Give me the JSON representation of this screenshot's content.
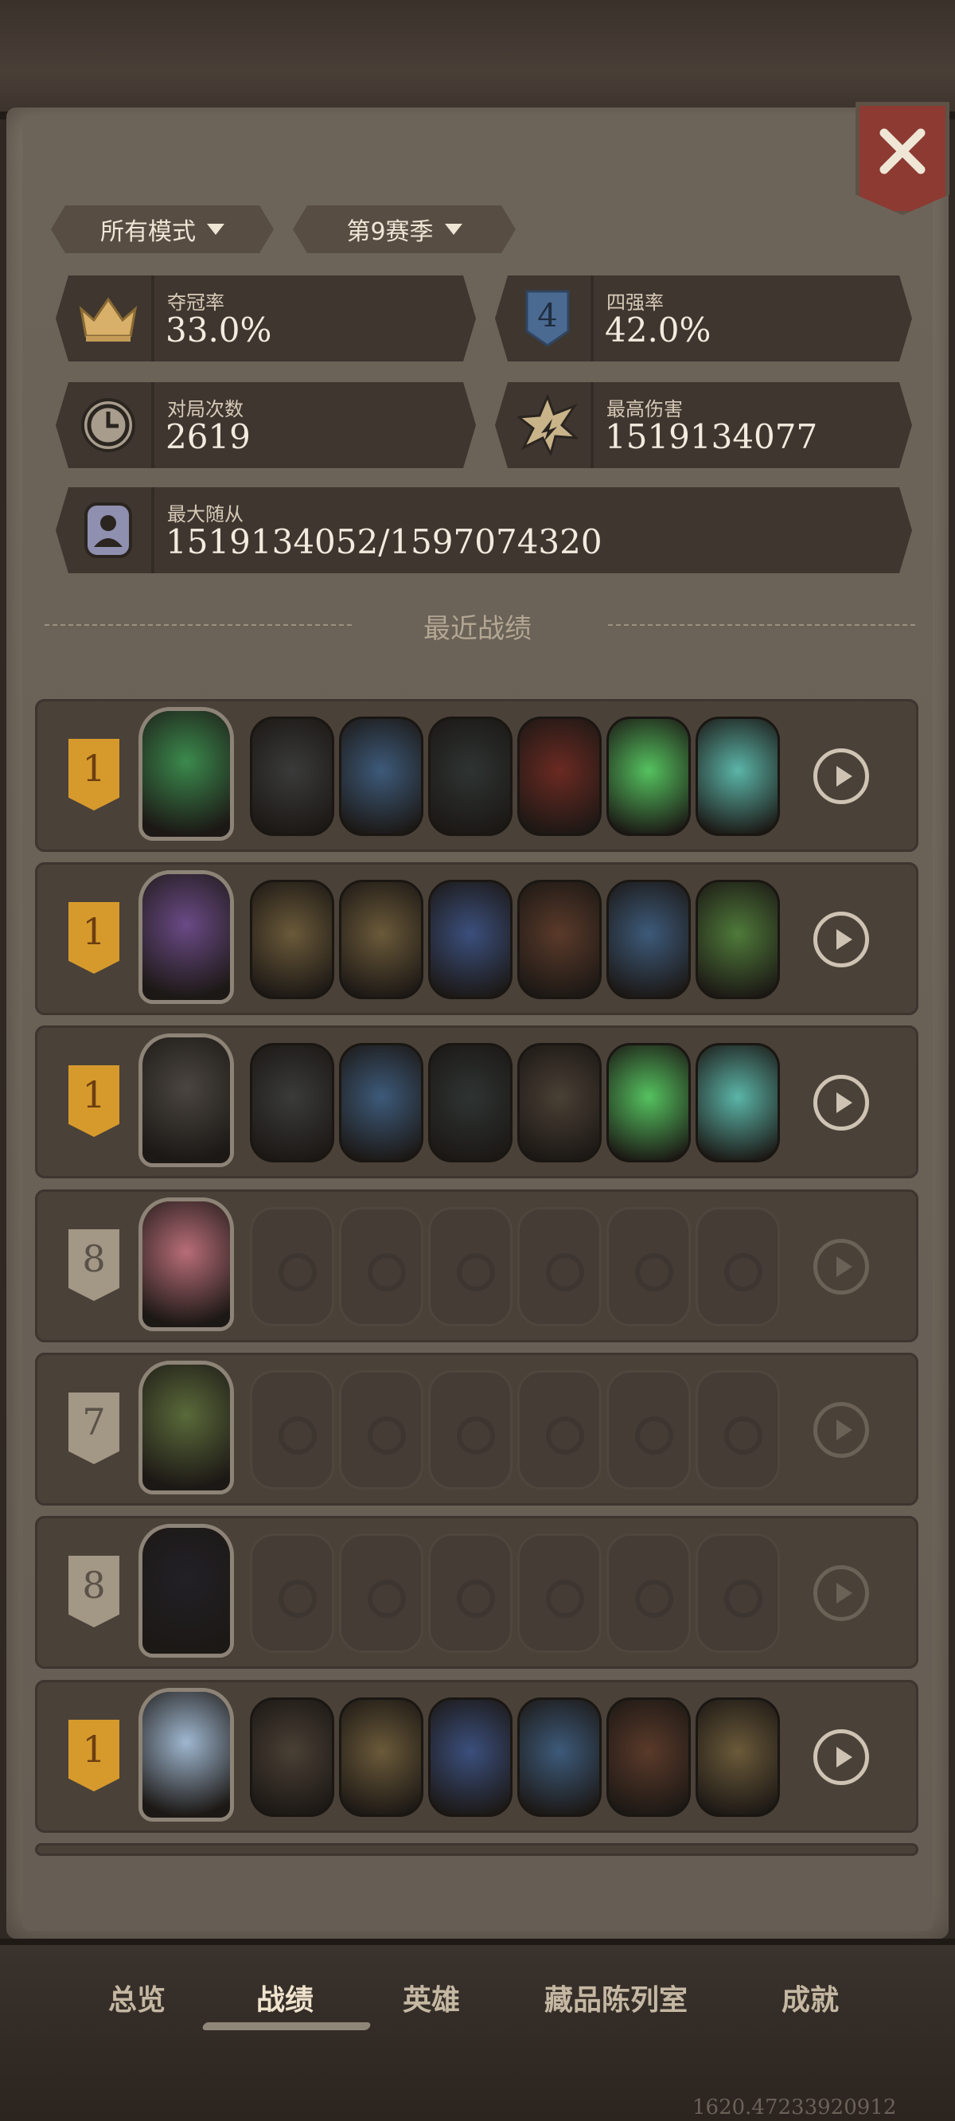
{
  "filters": [
    {
      "label": "所有模式"
    },
    {
      "label": "第9赛季"
    }
  ],
  "stats": {
    "win_rate": {
      "label": "夺冠率",
      "value": "33.0%",
      "icon": "crown-icon"
    },
    "top4_rate": {
      "label": "四强率",
      "value": "42.0%",
      "icon": "top4-shield-icon"
    },
    "games": {
      "label": "对局次数",
      "value": "2619",
      "icon": "clock-icon"
    },
    "max_damage": {
      "label": "最高伤害",
      "value": "1519134077",
      "icon": "burst-icon"
    },
    "max_minion": {
      "label": "最大随从",
      "value": "1519134052/1597074320",
      "icon": "portrait-icon"
    }
  },
  "section_title": "最近战绩",
  "records": [
    {
      "rank": "1",
      "rank_color": "gold",
      "hero_color": "#3b8a4d",
      "minions": [
        "#3a3b3a",
        "#3d5a7a",
        "#2e3433",
        "#6b2a22",
        "#55c25f",
        "#5bb5a8"
      ]
    },
    {
      "rank": "1",
      "rank_color": "gold",
      "hero_color": "#6a4a86",
      "minions": [
        "#6b5a3a",
        "#6b5a3a",
        "#3b4f7d",
        "#5a3a2a",
        "#3d5a7a",
        "#4f7a3a"
      ]
    },
    {
      "rank": "1",
      "rank_color": "gold",
      "hero_color": "#4a4540",
      "minions": [
        "#3a3b3a",
        "#3d5a7a",
        "#2e3433",
        "#4a4035",
        "#55c25f",
        "#5bb5a8"
      ]
    },
    {
      "rank": "8",
      "rank_color": "grey",
      "hero_color": "#b86d78",
      "minions": []
    },
    {
      "rank": "7",
      "rank_color": "grey",
      "hero_color": "#5a6a3a",
      "minions": []
    },
    {
      "rank": "8",
      "rank_color": "grey",
      "hero_color": "#222026",
      "minions": []
    },
    {
      "rank": "1",
      "rank_color": "gold",
      "hero_color": "#9fb7d0",
      "minions": [
        "#4a4035",
        "#6b5a3a",
        "#3b4f7d",
        "#3d5a7a",
        "#5a3a2a",
        "#6b5a3a"
      ]
    }
  ],
  "tabs": [
    {
      "label": "总览"
    },
    {
      "label": "战绩"
    },
    {
      "label": "英雄"
    },
    {
      "label": "藏品陈列室"
    },
    {
      "label": "成就"
    }
  ],
  "debug_text": "1620.47233920912"
}
